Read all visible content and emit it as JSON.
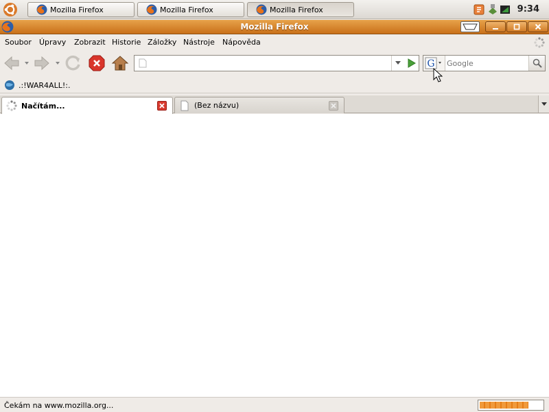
{
  "taskbar": {
    "buttons": [
      {
        "label": "Mozilla Firefox"
      },
      {
        "label": "Mozilla Firefox"
      },
      {
        "label": "Mozilla Firefox",
        "active": true
      }
    ],
    "clock": "9:34"
  },
  "window": {
    "title": "Mozilla Firefox"
  },
  "menubar": {
    "items": [
      "Soubor",
      "Úpravy",
      "Zobrazit",
      "Historie",
      "Záložky",
      "Nástroje",
      "Nápověda"
    ]
  },
  "navbar": {
    "url_value": "",
    "search_placeholder": "Google",
    "search_engine": "G"
  },
  "bookmarks": {
    "items": [
      ".:!WAR4ALL!:."
    ]
  },
  "tabs": [
    {
      "label": "Načítám...",
      "selected": true
    },
    {
      "label": "(Bez názvu)",
      "selected": false
    }
  ],
  "status": {
    "text": "Čekám na www.mozilla.org...",
    "progress": 0.78
  },
  "colors": {
    "titlebar": "#d9852f",
    "accent": "#e67d17"
  }
}
